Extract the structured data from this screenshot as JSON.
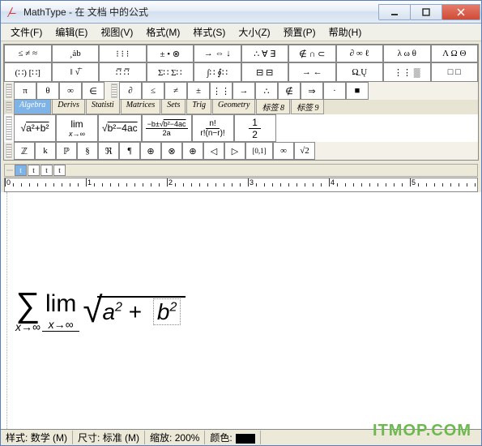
{
  "titlebar": {
    "title": "MathType - 在 文档 中的公式"
  },
  "menu": {
    "file": "文件(F)",
    "edit": "编辑(E)",
    "view": "视图(V)",
    "format": "格式(M)",
    "style": "样式(S)",
    "size": "大小(Z)",
    "preset": "预置(P)",
    "help": "帮助(H)"
  },
  "palette": {
    "row1": [
      "≤ ≠ ≈",
      "¸ȧb",
      "⁝ ⁝ ⁝",
      "± • ⊗",
      "→ ⇔ ↓",
      "∴ ∀ ∃",
      "∉ ∩ ⊂",
      "∂ ∞ ℓ",
      "λ ω θ",
      "Λ Ω Θ"
    ],
    "row2": [
      "(∷) [∷]",
      "‖ √̅",
      "∷̅  ∷̅",
      "Σ∷ Σ∷",
      "∫∷ ∮∷",
      "⊟ ⊟",
      "→  ←",
      "Ω̲ Ų",
      "⋮⋮ ▒",
      "□ □"
    ],
    "row3a": [
      "π",
      "θ",
      "∞",
      "∈"
    ],
    "row3b": [
      "∂",
      "≤",
      "≠",
      "±",
      "⋮⋮",
      "→",
      "∴",
      "∉",
      "⇒",
      "·",
      "■"
    ],
    "tabs": [
      {
        "label": "Algebra",
        "active": true
      },
      {
        "label": "Derivs",
        "active": false
      },
      {
        "label": "Statisti",
        "active": false
      },
      {
        "label": "Matrices",
        "active": false
      },
      {
        "label": "Sets",
        "active": false
      },
      {
        "label": "Trig",
        "active": false
      },
      {
        "label": "Geometry",
        "active": false
      },
      {
        "label": "标签 8",
        "active": false
      },
      {
        "label": "标签 9",
        "active": false
      }
    ],
    "big": [
      {
        "latex": "√(a²+b²)"
      },
      {
        "latex": "lim x→∞"
      },
      {
        "latex": "√(b²−4ac)"
      },
      {
        "latex": "(−b±√(b²−4ac))/2a"
      },
      {
        "latex": "n! / r!(n−r)!"
      },
      {
        "latex": "1/2"
      }
    ],
    "row5": [
      "ℤ",
      "k",
      "ℙ",
      "§",
      "ℜ",
      "¶",
      "⊕",
      "⊗",
      "⊕",
      "◁",
      "▷",
      "[0,1]",
      "∞",
      "√2"
    ]
  },
  "sizes": {
    "items": [
      "t",
      "t",
      "t",
      "t"
    ],
    "current": 0
  },
  "ruler": {
    "labels": [
      "0",
      "1",
      "2",
      "3",
      "4",
      "5"
    ]
  },
  "formula": {
    "sigma": "∑",
    "sigma_sub": "x→∞",
    "lim": "lim",
    "lim_sub": "x→∞",
    "radical": "√",
    "exprA": "a",
    "sup1": "2",
    "plus": "+",
    "exprB": "b",
    "sup2": "2"
  },
  "status": {
    "style_lbl": "样式:",
    "style_val": "数学 (M)",
    "size_lbl": "尺寸:",
    "size_val": "标准 (M)",
    "zoom_lbl": "缩放:",
    "zoom_val": "200%",
    "color_lbl": "颜色:"
  },
  "watermark": "ITMOP.COM"
}
